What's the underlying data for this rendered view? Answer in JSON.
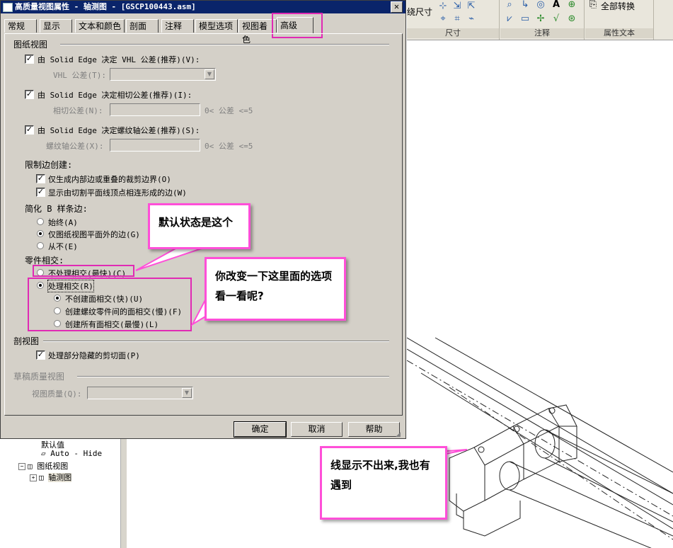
{
  "window": {
    "title": "高质量视图属性 - 轴测图 - [GSCP100443.asm]",
    "close": "✕"
  },
  "tabs": [
    {
      "label": "常规"
    },
    {
      "label": "显示"
    },
    {
      "label": "文本和颜色"
    },
    {
      "label": "剖面"
    },
    {
      "label": "注释"
    },
    {
      "label": "模型选项"
    },
    {
      "label": "视图着色"
    },
    {
      "label": "高级"
    }
  ],
  "sections": {
    "drawing_view": {
      "title": "图纸视图",
      "vhl_checkbox": "由 Solid Edge 决定 VHL 公差(推荐)(V):",
      "vhl_field_label": "VHL 公差(T):",
      "tangent_checkbox": "由 Solid Edge 决定相切公差(推荐)(I):",
      "tangent_field_label": "相切公差(N):",
      "tangent_range": "0< 公差 <=5",
      "thread_checkbox": "由 Solid Edge 决定螺纹轴公差(推荐)(S):",
      "thread_field_label": "螺纹轴公差(X):",
      "thread_range": "0< 公差 <=5",
      "edge_creation_title": "限制边创建:",
      "edge_opt1": "仅生成内部边或重叠的裁剪边界(O)",
      "edge_opt2": "显示由切割平面线顶点相连形成的边(W)",
      "bspline_title": "简化 B 样条边:",
      "bspline_opt1": "始终(A)",
      "bspline_opt2": "仅图纸视图平面外的边(G)",
      "bspline_opt3": "从不(E)",
      "part_title": "零件相交:",
      "part_opt1": "不处理相交(最快)(C)",
      "part_opt2": "处理相交(R)",
      "part_sub1": "不创建面相交(快)(U)",
      "part_sub2": "创建螺纹零件间的面相交(慢)(F)",
      "part_sub3": "创建所有面相交(最慢)(L)"
    },
    "section_view": {
      "title": "剖视图",
      "opt1": "处理部分隐藏的剪切面(P)"
    },
    "draft_quality": {
      "title": "草稿质量视图",
      "field_label": "视图质量(Q):"
    }
  },
  "buttons": {
    "ok": "确定",
    "cancel": "取消",
    "help": "帮助"
  },
  "ribbon": {
    "groups": [
      {
        "label": "尺寸",
        "partial_text": "绕尺寸"
      },
      {
        "label": "注释"
      },
      {
        "label": "属性文本",
        "button": "全部转换"
      }
    ]
  },
  "tree": {
    "items": [
      {
        "label": "默认值"
      },
      {
        "label": "Auto - Hide"
      },
      {
        "label": "图纸视图"
      },
      {
        "label": "轴测图"
      }
    ]
  },
  "callouts": {
    "c1": "默认状态是这个",
    "c2": "你改变一下这里面的选项看一看呢?",
    "c3": "线显示不出来,我也有遇到"
  },
  "colors": {
    "highlight": "#e02ab4",
    "callout_border": "#ff4fd8",
    "titlebar": "#0a246a"
  }
}
